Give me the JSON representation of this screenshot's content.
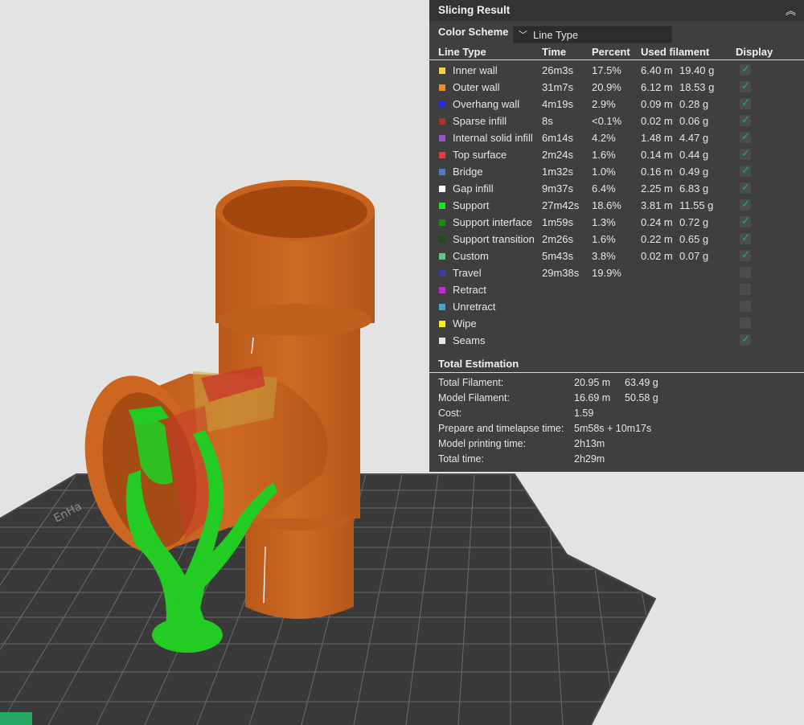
{
  "panel": {
    "title": "Slicing Result",
    "collapse_icon": "double-chevron-up",
    "color_scheme_label": "Color Scheme",
    "color_scheme_value": "Line Type"
  },
  "table": {
    "headers": {
      "line_type": "Line Type",
      "time": "Time",
      "percent": "Percent",
      "used_filament": "Used filament",
      "display": "Display"
    },
    "rows": [
      {
        "label": "Inner wall",
        "color": "#f2d340",
        "time": "26m3s",
        "percent": "17.5%",
        "length": "6.40 m",
        "weight": "19.40 g",
        "display": true,
        "show_check": true
      },
      {
        "label": "Outer wall",
        "color": "#f08a2e",
        "time": "31m7s",
        "percent": "20.9%",
        "length": "6.12 m",
        "weight": "18.53 g",
        "display": true,
        "show_check": true
      },
      {
        "label": "Overhang wall",
        "color": "#2626ea",
        "time": "4m19s",
        "percent": "2.9%",
        "length": "0.09 m",
        "weight": "0.28 g",
        "display": true,
        "show_check": true
      },
      {
        "label": "Sparse infill",
        "color": "#b0312a",
        "time": "8s",
        "percent": "<0.1%",
        "length": "0.02 m",
        "weight": "0.06 g",
        "display": true,
        "show_check": true
      },
      {
        "label": "Internal solid infill",
        "color": "#9a52c8",
        "time": "6m14s",
        "percent": "4.2%",
        "length": "1.48 m",
        "weight": "4.47 g",
        "display": true,
        "show_check": true
      },
      {
        "label": "Top surface",
        "color": "#e33f3f",
        "time": "2m24s",
        "percent": "1.6%",
        "length": "0.14 m",
        "weight": "0.44 g",
        "display": true,
        "show_check": true
      },
      {
        "label": "Bridge",
        "color": "#4d80ba",
        "time": "1m32s",
        "percent": "1.0%",
        "length": "0.16 m",
        "weight": "0.49 g",
        "display": true,
        "show_check": true
      },
      {
        "label": "Gap infill",
        "color": "#ffffff",
        "time": "9m37s",
        "percent": "6.4%",
        "length": "2.25 m",
        "weight": "6.83 g",
        "display": true,
        "show_check": true
      },
      {
        "label": "Support",
        "color": "#22e022",
        "time": "27m42s",
        "percent": "18.6%",
        "length": "3.81 m",
        "weight": "11.55 g",
        "display": true,
        "show_check": true
      },
      {
        "label": "Support interface",
        "color": "#1f8a1f",
        "time": "1m59s",
        "percent": "1.3%",
        "length": "0.24 m",
        "weight": "0.72 g",
        "display": true,
        "show_check": true
      },
      {
        "label": "Support transition",
        "color": "#1a4d1a",
        "time": "2m26s",
        "percent": "1.6%",
        "length": "0.22 m",
        "weight": "0.65 g",
        "display": true,
        "show_check": true
      },
      {
        "label": "Custom",
        "color": "#5ec48a",
        "time": "5m43s",
        "percent": "3.8%",
        "length": "0.02 m",
        "weight": "0.07 g",
        "display": true,
        "show_check": true
      },
      {
        "label": "Travel",
        "color": "#3d3d9a",
        "time": "29m38s",
        "percent": "19.9%",
        "length": "",
        "weight": "",
        "display": false,
        "show_check": false
      },
      {
        "label": "Retract",
        "color": "#c82ad0",
        "time": "",
        "percent": "",
        "length": "",
        "weight": "",
        "display": false,
        "show_check": false
      },
      {
        "label": "Unretract",
        "color": "#3fa6c8",
        "time": "",
        "percent": "",
        "length": "",
        "weight": "",
        "display": false,
        "show_check": false
      },
      {
        "label": "Wipe",
        "color": "#f2f21a",
        "time": "",
        "percent": "",
        "length": "",
        "weight": "",
        "display": false,
        "show_check": false
      },
      {
        "label": "Seams",
        "color": "#e6e6e6",
        "time": "",
        "percent": "",
        "length": "",
        "weight": "",
        "display": true,
        "show_check": true
      }
    ]
  },
  "total": {
    "title": "Total Estimation",
    "rows": [
      {
        "label": "Total Filament:",
        "v1": "20.95 m",
        "v2": "63.49 g"
      },
      {
        "label": "Model Filament:",
        "v1": "16.69 m",
        "v2": "50.58 g"
      },
      {
        "label": "Cost:",
        "v1": "1.59",
        "v2": ""
      },
      {
        "label": "Prepare and timelapse time:",
        "v1": "5m58s + 10m17s",
        "v2": ""
      },
      {
        "label": "Model printing time:",
        "v1": "2h13m",
        "v2": ""
      },
      {
        "label": "Total time:",
        "v1": "2h29m",
        "v2": ""
      }
    ]
  },
  "scene": {
    "background_color": "#e3e3e3",
    "bed_color": "#3a3a3a",
    "pipe_color": "#c8631e",
    "support_color": "#22cc22",
    "bed_marking": "EnHa"
  }
}
